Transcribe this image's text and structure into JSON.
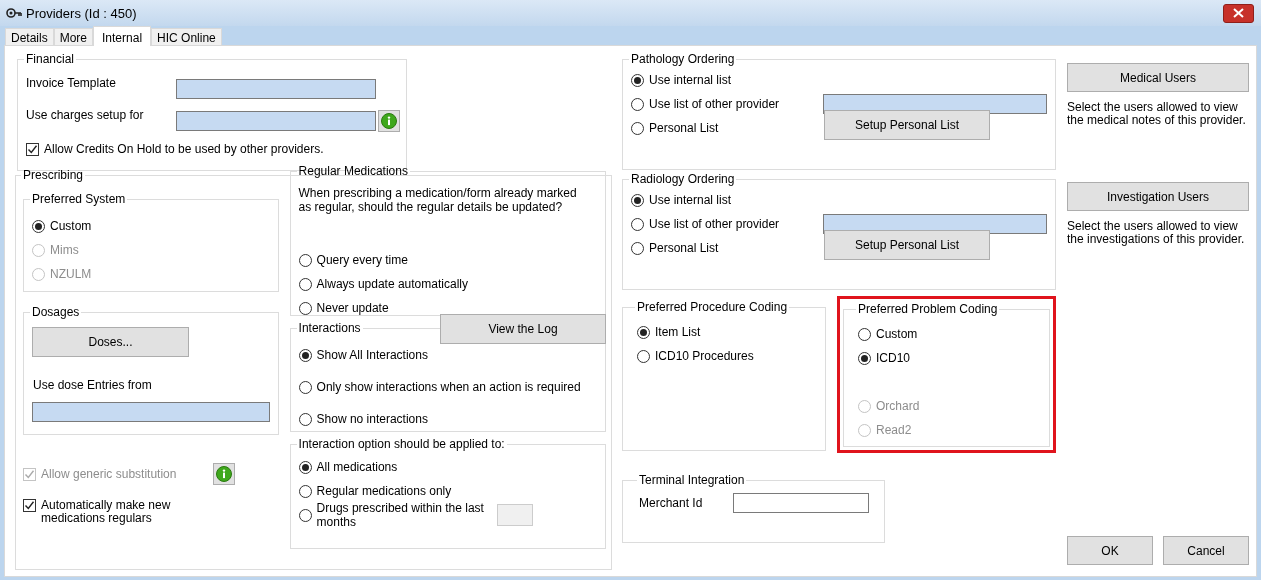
{
  "window": {
    "title": "Providers (Id : 450)"
  },
  "tabs": [
    {
      "label": "Details",
      "selected": false
    },
    {
      "label": "More",
      "selected": false
    },
    {
      "label": "Internal",
      "selected": true
    },
    {
      "label": "HIC Online",
      "selected": false
    }
  ],
  "financial": {
    "title": "Financial",
    "invoice_template": {
      "label": "Invoice Template",
      "highlighted": true
    },
    "charges_setup": {
      "label": "Use charges setup for",
      "highlighted": true
    },
    "allow_credits": {
      "label": "Allow Credits On Hold to be used by other providers.",
      "checked": true,
      "disabled": false
    }
  },
  "prescribing": {
    "title": "Prescribing",
    "preferred_system": {
      "title": "Preferred System",
      "options": [
        {
          "label": "Custom",
          "selected": true,
          "disabled": false
        },
        {
          "label": "Mims",
          "selected": false,
          "disabled": true
        },
        {
          "label": "NZULM",
          "selected": false,
          "disabled": true
        }
      ]
    },
    "dosages": {
      "title": "Dosages",
      "button": "Doses...",
      "entries_label": "Use dose Entries from",
      "entries_field": {
        "highlighted": true
      }
    },
    "allow_generic": {
      "label": "Allow generic substitution",
      "checked": true,
      "disabled": true
    },
    "auto_regulars": {
      "label": "Automatically make new medications regulars",
      "checked": true,
      "disabled": false
    },
    "regular_medications": {
      "title": "Regular Medications",
      "question": "When prescribing a medication/form already marked as regular, should the regular details be updated?",
      "options": [
        {
          "label": "Query every time",
          "selected": false,
          "disabled": false
        },
        {
          "label": "Always update automatically",
          "selected": false,
          "disabled": false
        },
        {
          "label": "Never update",
          "selected": false,
          "disabled": false
        }
      ],
      "button": "View the Log"
    },
    "interactions": {
      "title": "Interactions",
      "options": [
        {
          "label": "Show All Interactions",
          "selected": true,
          "disabled": false
        },
        {
          "label": "Only show interactions when an action is required",
          "selected": false,
          "disabled": false
        },
        {
          "label": "Show no interactions",
          "selected": false,
          "disabled": false
        }
      ]
    },
    "interaction_scope": {
      "title": "Interaction option should be applied to:",
      "options": [
        {
          "label": "All medications",
          "selected": true,
          "disabled": false
        },
        {
          "label": "Regular medications only",
          "selected": false,
          "disabled": false
        },
        {
          "label": "Drugs prescribed within the last months",
          "selected": false,
          "disabled": false
        }
      ],
      "months_field": {
        "disabled": true
      }
    }
  },
  "pathology": {
    "title": "Pathology Ordering",
    "options": [
      {
        "label": "Use internal list",
        "selected": true,
        "disabled": false
      },
      {
        "label": "Use list of other provider",
        "selected": false,
        "disabled": false
      },
      {
        "label": "Personal List",
        "selected": false,
        "disabled": false
      }
    ],
    "provider_field": {
      "highlighted": true
    },
    "button": "Setup Personal List"
  },
  "radiology": {
    "title": "Radiology Ordering",
    "options": [
      {
        "label": "Use internal list",
        "selected": true,
        "disabled": false
      },
      {
        "label": "Use list of other provider",
        "selected": false,
        "disabled": false
      },
      {
        "label": "Personal List",
        "selected": false,
        "disabled": false
      }
    ],
    "provider_field": {
      "highlighted": true
    },
    "button": "Setup Personal List"
  },
  "procedure_coding": {
    "title": "Preferred Procedure Coding",
    "options": [
      {
        "label": "Item List",
        "selected": true,
        "disabled": false
      },
      {
        "label": "ICD10 Procedures",
        "selected": false,
        "disabled": false
      }
    ]
  },
  "problem_coding": {
    "title": "Preferred Problem Coding",
    "highlighted": true,
    "options": [
      {
        "label": "Custom",
        "selected": false,
        "disabled": false
      },
      {
        "label": "ICD10",
        "selected": true,
        "disabled": false
      },
      {
        "label": "Orchard",
        "selected": false,
        "disabled": true
      },
      {
        "label": "Read2",
        "selected": false,
        "disabled": true
      }
    ]
  },
  "terminal": {
    "title": "Terminal Integration",
    "merchant_label": "Merchant Id",
    "merchant_field": {
      "highlighted": false
    }
  },
  "medical_users": {
    "button": "Medical Users",
    "note": "Select the users allowed to view the medical notes of this provider."
  },
  "investigation_users": {
    "button": "Investigation Users",
    "note": "Select the users allowed to view the investigations of this provider."
  },
  "buttons": [
    "OK",
    "Cancel"
  ]
}
